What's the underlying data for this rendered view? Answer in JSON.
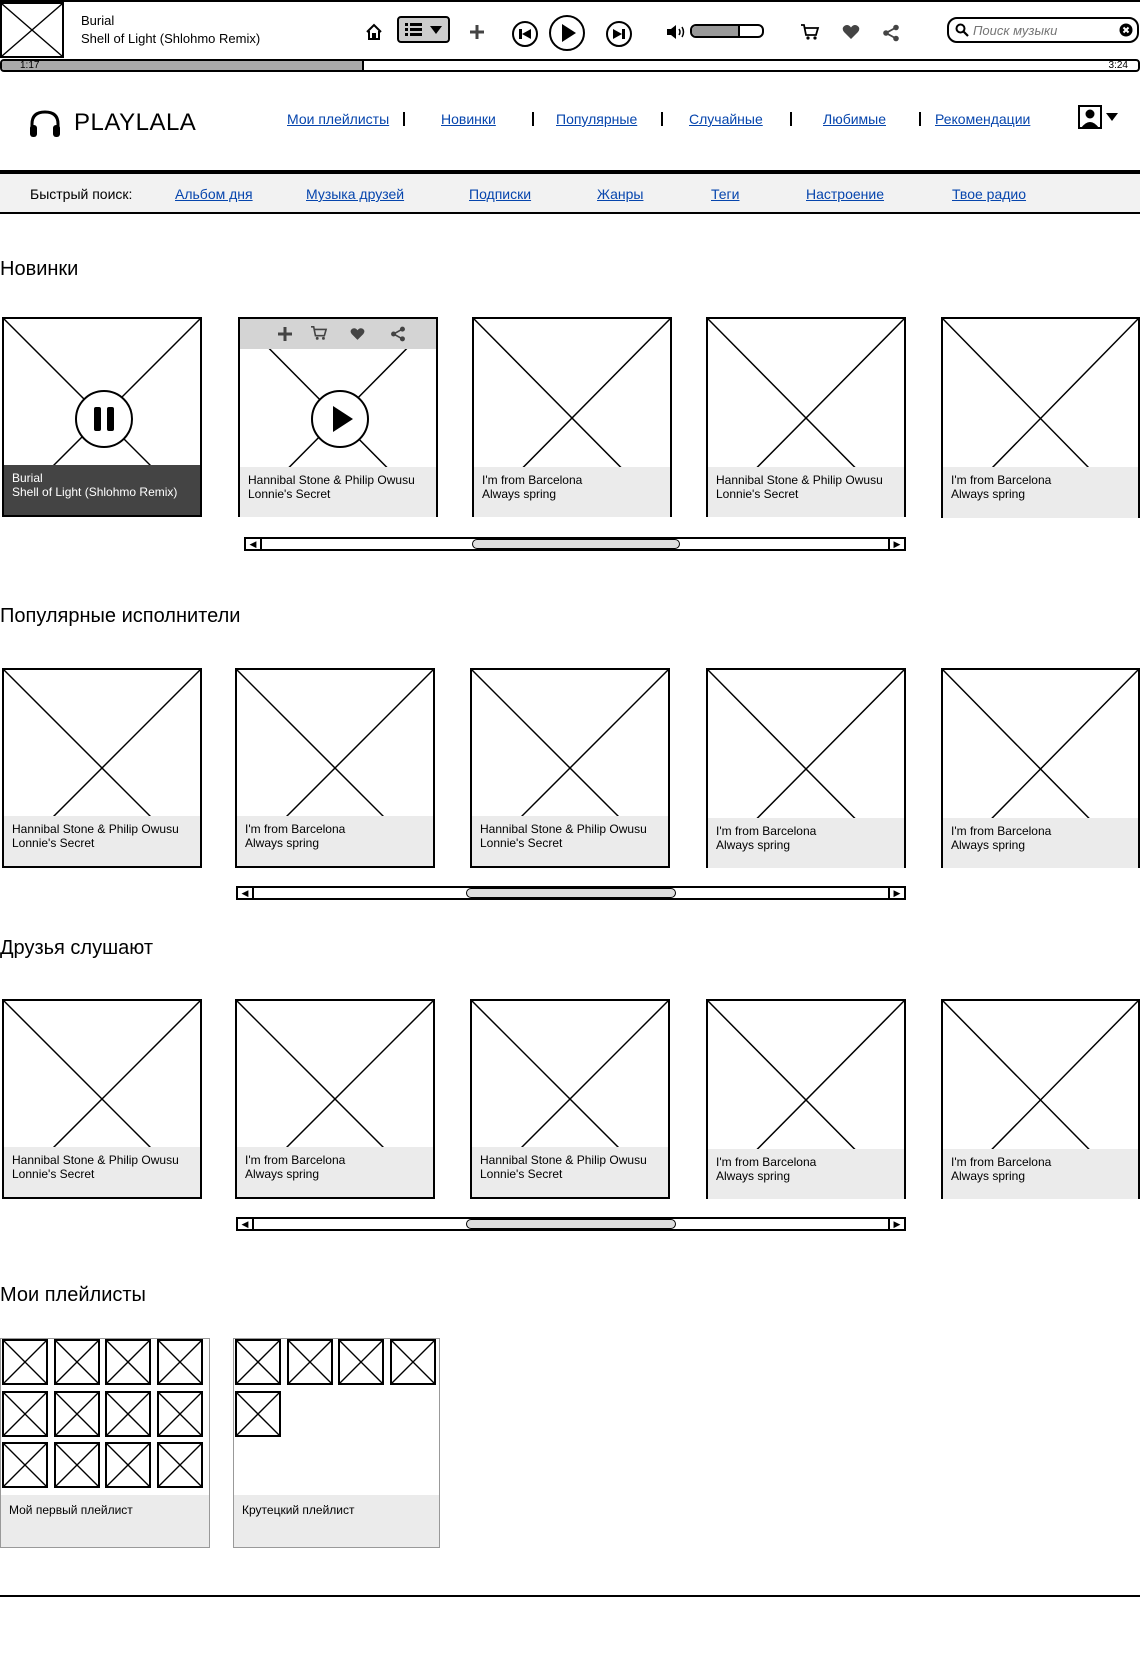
{
  "player": {
    "artist": "Burial",
    "track": "Shell of Light (Shlohmo Remix)",
    "time_current": "1:17",
    "time_total": "3:24",
    "progress": 0.317,
    "volume": 0.65,
    "search_placeholder": "Поиск музыки"
  },
  "header": {
    "logo": "PLAYLALA",
    "nav": [
      "Мои плейлисты",
      "Новинки",
      "Популярные",
      "Случайные",
      "Любимые",
      "Рекомендации"
    ]
  },
  "quick_search": {
    "label": "Быстрый поиск:",
    "links": [
      "Альбом дня",
      "Музыка друзей",
      "Подписки",
      "Жанры",
      "Теги",
      "Настроение",
      "Твое радио"
    ]
  },
  "sections": {
    "new": {
      "title": "Новинки",
      "cards": [
        {
          "artist": "Burial",
          "track": "Shell of Light (Shlohmo Remix)"
        },
        {
          "artist": "Hannibal Stone & Philip Owusu",
          "track": "Lonnie's Secret"
        },
        {
          "artist": "I'm from Barcelona",
          "track": "Always spring"
        },
        {
          "artist": "Hannibal Stone & Philip Owusu",
          "track": "Lonnie's Secret"
        },
        {
          "artist": "I'm from Barcelona",
          "track": "Always spring"
        }
      ]
    },
    "popular": {
      "title": "Популярные исполнители",
      "cards": [
        {
          "artist": "Hannibal Stone & Philip Owusu",
          "track": "Lonnie's Secret"
        },
        {
          "artist": "I'm from Barcelona",
          "track": "Always spring"
        },
        {
          "artist": "Hannibal Stone & Philip Owusu",
          "track": "Lonnie's Secret"
        },
        {
          "artist": "I'm from Barcelona",
          "track": "Always spring"
        },
        {
          "artist": "I'm from Barcelona",
          "track": "Always spring"
        }
      ]
    },
    "friends": {
      "title": "Друзья слушают",
      "cards": [
        {
          "artist": "Hannibal Stone & Philip Owusu",
          "track": "Lonnie's Secret"
        },
        {
          "artist": "I'm from Barcelona",
          "track": "Always spring"
        },
        {
          "artist": "Hannibal Stone & Philip Owusu",
          "track": "Lonnie's Secret"
        },
        {
          "artist": "I'm from Barcelona",
          "track": "Always spring"
        },
        {
          "artist": "I'm from Barcelona",
          "track": "Always spring"
        }
      ]
    },
    "playlists": {
      "title": "Мои плейлисты",
      "items": [
        {
          "name": "Мой первый плейлист"
        },
        {
          "name": "Крутецкий плейлист"
        }
      ]
    }
  }
}
